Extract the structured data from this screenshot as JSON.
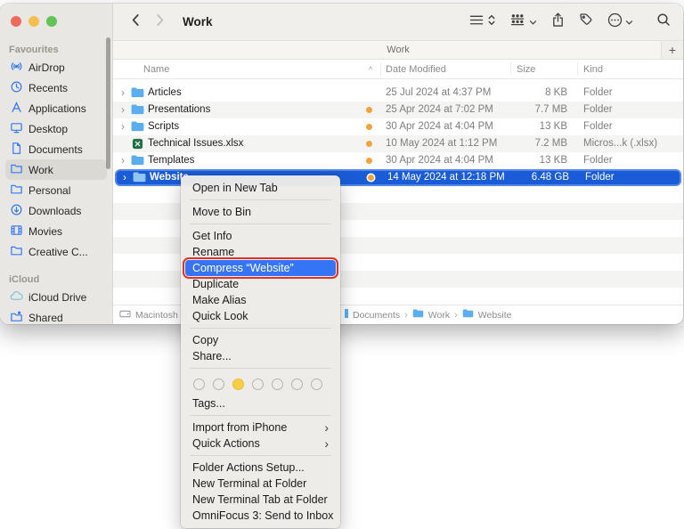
{
  "toolbar": {
    "title": "Work"
  },
  "tab_bar": {
    "active_tab": "Work",
    "new_tab_label": "+"
  },
  "sidebar": {
    "sections": [
      {
        "label": "Favourites",
        "items": [
          {
            "label": "AirDrop"
          },
          {
            "label": "Recents"
          },
          {
            "label": "Applications"
          },
          {
            "label": "Desktop"
          },
          {
            "label": "Documents"
          },
          {
            "label": "Work"
          },
          {
            "label": "Personal"
          },
          {
            "label": "Downloads"
          },
          {
            "label": "Movies"
          },
          {
            "label": "Creative C..."
          }
        ]
      },
      {
        "label": "iCloud",
        "items": [
          {
            "label": "iCloud Drive"
          },
          {
            "label": "Shared"
          }
        ]
      }
    ]
  },
  "file_list": {
    "columns": [
      "Name",
      "Date Modified",
      "Size",
      "Kind"
    ],
    "sort_indicator": "^",
    "rows": [
      {
        "name": "Articles",
        "date": "25 Jul 2024 at 4:37 PM",
        "size": "8 KB",
        "kind": "Folder"
      },
      {
        "name": "Presentations",
        "date": "25 Apr 2024 at 7:02 PM",
        "size": "7.7 MB",
        "kind": "Folder"
      },
      {
        "name": "Scripts",
        "date": "30 Apr 2024 at 4:04 PM",
        "size": "13 KB",
        "kind": "Folder"
      },
      {
        "name": "Technical Issues.xlsx",
        "date": "10 May 2024 at 1:12 PM",
        "size": "7.2 MB",
        "kind": "Micros...k (.xlsx)"
      },
      {
        "name": "Templates",
        "date": "30 Apr 2024 at 4:04 PM",
        "size": "13 KB",
        "kind": "Folder"
      },
      {
        "name": "Website",
        "date": "14 May 2024 at 12:18 PM",
        "size": "6.48 GB",
        "kind": "Folder"
      }
    ]
  },
  "status_bar": {
    "separator": "›",
    "path": [
      {
        "label": "Macintosh H"
      },
      {
        "label": "Documents"
      },
      {
        "label": "Work"
      },
      {
        "label": "Website"
      }
    ]
  },
  "context_menu": {
    "submenu_arrow": "›",
    "items": {
      "open_new_tab": "Open in New Tab",
      "move_to_bin": "Move to Bin",
      "get_info": "Get Info",
      "rename": "Rename",
      "compress": "Compress “Website”",
      "duplicate": "Duplicate",
      "make_alias": "Make Alias",
      "quick_look": "Quick Look",
      "copy": "Copy",
      "share": "Share...",
      "tags": "Tags...",
      "import_iphone": "Import from iPhone",
      "quick_actions": "Quick Actions",
      "folder_actions": "Folder Actions Setup...",
      "terminal": "New Terminal at Folder",
      "terminal_tab": "New Terminal Tab at Folder",
      "omnifocus": "OmniFocus 3: Send to Inbox"
    }
  },
  "colors": {
    "selection_blue": "#1a5cd7",
    "menu_highlight_blue": "#3574f5",
    "annotation_red": "#de3227",
    "tag_orange": "#f2a33c",
    "tag_yellow": "#f8ce47",
    "sidebar_icon_blue": "#3478f6"
  }
}
